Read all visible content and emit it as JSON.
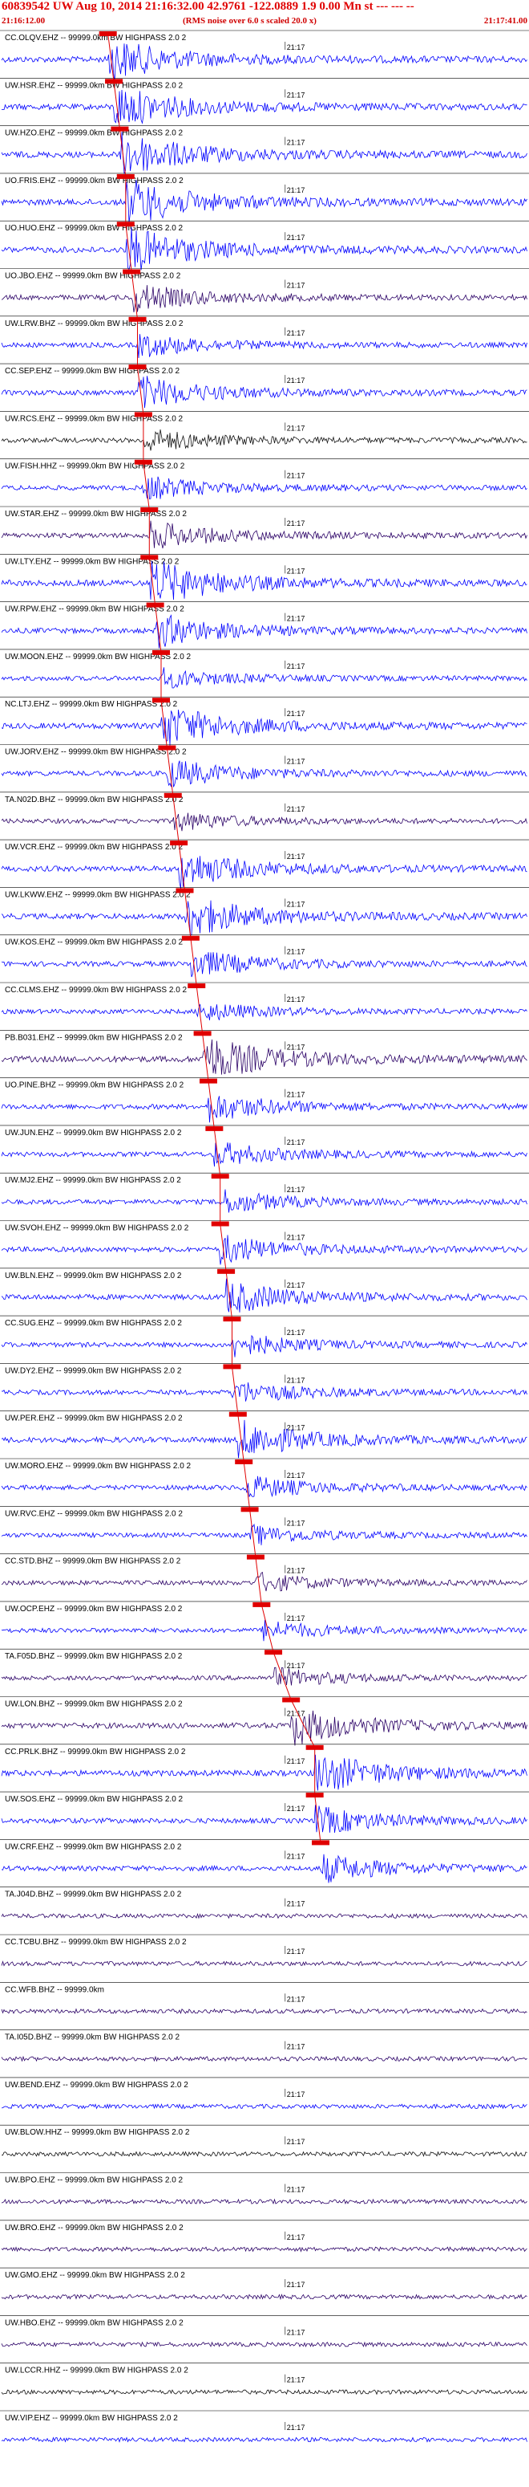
{
  "header": {
    "title": "60839542 UW Aug 10, 2014 21:16:32.00   42.9761 -122.0889  1.9 0.00 Mn st --- --- --",
    "start_time": "21:16:12.00",
    "note": "(RMS noise over 6.0 s scaled 20.0 x)",
    "end_time": "21:17:41.00"
  },
  "colors": {
    "trace_blue": "#0000ff",
    "trace_dark": "#2a0066",
    "trace_black": "#111111",
    "pick": "#e00000",
    "divider": "#000000"
  },
  "chart_data": {
    "type": "line",
    "title": "60839542 UW Aug 10, 2014 21:16:32.00   42.9761 -122.0889  1.9 0.00 Mn st --- --- --",
    "x_range": [
      "21:16:12.00",
      "21:17:41.00"
    ],
    "tick_label": "21:17",
    "tick_time": "21:17:00",
    "event_time": "21:16:32.00",
    "grid": false,
    "series": [
      {
        "label": "CC.OLQV.EHZ -- 99999.0km BW  HIGHPASS  2.0  2",
        "color": "blue",
        "arrival": "21:16:30",
        "amp": 0.9
      },
      {
        "label": "UW.HSR.EHZ -- 99999.0km BW  HIGHPASS  2.0  2",
        "color": "blue",
        "arrival": "21:16:31",
        "amp": 0.9
      },
      {
        "label": "UW.HZO.EHZ -- 99999.0km BW  HIGHPASS  2.0  2",
        "color": "blue",
        "arrival": "21:16:32",
        "amp": 1.0
      },
      {
        "label": "UO.FRIS.EHZ -- 99999.0km BW  HIGHPASS  2.0  2",
        "color": "blue",
        "arrival": "21:16:33",
        "amp": 1.0
      },
      {
        "label": "UO.HUO.EHZ -- 99999.0km BW  HIGHPASS  2.0  2",
        "color": "blue",
        "arrival": "21:16:33",
        "amp": 1.0
      },
      {
        "label": "UO.JBO.EHZ -- 99999.0km BW  HIGHPASS  2.0  2",
        "color": "dark",
        "arrival": "21:16:34",
        "amp": 0.6
      },
      {
        "label": "UW.LRW.BHZ -- 99999.0km BW  HIGHPASS  2.0  2",
        "color": "blue",
        "arrival": "21:16:35",
        "amp": 0.5
      },
      {
        "label": "CC.SEP.EHZ -- 99999.0km BW  HIGHPASS  2.0  2",
        "color": "blue",
        "arrival": "21:16:35",
        "amp": 0.7
      },
      {
        "label": "UW.RCS.EHZ -- 99999.0km BW  HIGHPASS  2.0  2",
        "color": "black",
        "arrival": "21:16:36",
        "amp": 0.5
      },
      {
        "label": "UW.FISH.HHZ -- 99999.0km BW  HIGHPASS  2.0  2",
        "color": "blue",
        "arrival": "21:16:36",
        "amp": 0.5
      },
      {
        "label": "UW.STAR.EHZ -- 99999.0km BW  HIGHPASS  2.0  2",
        "color": "dark",
        "arrival": "21:16:37",
        "amp": 0.6
      },
      {
        "label": "UW.LTY.EHZ -- 99999.0km BW  HIGHPASS  2.0  2",
        "color": "blue",
        "arrival": "21:16:37",
        "amp": 1.0
      },
      {
        "label": "UW.RPW.EHZ -- 99999.0km BW  HIGHPASS  2.0  2",
        "color": "blue",
        "arrival": "21:16:38",
        "amp": 0.7
      },
      {
        "label": "UW.MOON.EHZ -- 99999.0km BW  HIGHPASS  2.0  2",
        "color": "blue",
        "arrival": "21:16:39",
        "amp": 0.4
      },
      {
        "label": "NC.LTJ.EHZ -- 99999.0km BW  HIGHPASS  2.0  2",
        "color": "blue",
        "arrival": "21:16:39",
        "amp": 0.9
      },
      {
        "label": "UW.JORV.EHZ -- 99999.0km BW  HIGHPASS  2.0  2",
        "color": "blue",
        "arrival": "21:16:40",
        "amp": 0.6
      },
      {
        "label": "TA.N02D.BHZ -- 99999.0km BW  HIGHPASS  2.0  2",
        "color": "dark",
        "arrival": "21:16:41",
        "amp": 0.4
      },
      {
        "label": "UW.VCR.EHZ -- 99999.0km BW  HIGHPASS  2.0  2",
        "color": "blue",
        "arrival": "21:16:42",
        "amp": 0.8
      },
      {
        "label": "UW.LKWW.EHZ -- 99999.0km BW  HIGHPASS  2.0  2",
        "color": "blue",
        "arrival": "21:16:43",
        "amp": 0.9
      },
      {
        "label": "UW.KOS.EHZ -- 99999.0km BW  HIGHPASS  2.0  2",
        "color": "blue",
        "arrival": "21:16:44",
        "amp": 0.6
      },
      {
        "label": "CC.CLMS.EHZ -- 99999.0km BW  HIGHPASS  2.0  2",
        "color": "blue",
        "arrival": "21:16:45",
        "amp": 0.4
      },
      {
        "label": "PB.B031.EHZ -- 99999.0km BW  HIGHPASS  2.0  2",
        "color": "dark",
        "arrival": "21:16:46",
        "amp": 1.0
      },
      {
        "label": "UO.PINE.BHZ -- 99999.0km BW  HIGHPASS  2.0  2",
        "color": "blue",
        "arrival": "21:16:47",
        "amp": 0.6
      },
      {
        "label": "UW.JUN.EHZ -- 99999.0km BW  HIGHPASS  2.0  2",
        "color": "blue",
        "arrival": "21:16:48",
        "amp": 0.5
      },
      {
        "label": "UW.MJ2.EHZ -- 99999.0km BW  HIGHPASS  2.0  2",
        "color": "blue",
        "arrival": "21:16:49",
        "amp": 0.5
      },
      {
        "label": "UW.SVOH.EHZ -- 99999.0km BW  HIGHPASS  2.0  2",
        "color": "blue",
        "arrival": "21:16:49",
        "amp": 0.6
      },
      {
        "label": "UW.BLN.EHZ -- 99999.0km BW  HIGHPASS  2.0  2",
        "color": "blue",
        "arrival": "21:16:50",
        "amp": 0.7
      },
      {
        "label": "CC.SUG.EHZ -- 99999.0km BW  HIGHPASS  2.0  2",
        "color": "blue",
        "arrival": "21:16:51",
        "amp": 0.5
      },
      {
        "label": "UW.DY2.EHZ -- 99999.0km BW  HIGHPASS  2.0  2",
        "color": "blue",
        "arrival": "21:16:51",
        "amp": 0.5
      },
      {
        "label": "UW.PER.EHZ -- 99999.0km BW  HIGHPASS  2.0  2",
        "color": "blue",
        "arrival": "21:16:52",
        "amp": 0.8
      },
      {
        "label": "UW.MORO.EHZ -- 99999.0km BW  HIGHPASS  2.0  2",
        "color": "blue",
        "arrival": "21:16:53",
        "amp": 0.5
      },
      {
        "label": "UW.RVC.EHZ -- 99999.0km BW  HIGHPASS  2.0  2",
        "color": "blue",
        "arrival": "21:16:54",
        "amp": 0.4
      },
      {
        "label": "CC.STD.BHZ -- 99999.0km BW  HIGHPASS  2.0  2",
        "color": "dark",
        "arrival": "21:16:55",
        "amp": 0.4
      },
      {
        "label": "UW.OCP.EHZ -- 99999.0km BW  HIGHPASS  2.0  2",
        "color": "blue",
        "arrival": "21:16:56",
        "amp": 0.4
      },
      {
        "label": "TA.F05D.BHZ -- 99999.0km BW  HIGHPASS  2.0  2",
        "color": "dark",
        "arrival": "21:16:58",
        "amp": 0.4
      },
      {
        "label": "UW.LON.BHZ -- 99999.0km BW  HIGHPASS  2.0  2",
        "color": "dark",
        "arrival": "21:17:01",
        "amp": 0.8
      },
      {
        "label": "CC.PRLK.BHZ -- 99999.0km BW  HIGHPASS  2.0  2",
        "color": "blue",
        "arrival": "21:17:05",
        "amp": 0.9
      },
      {
        "label": "UW.SOS.EHZ -- 99999.0km BW  HIGHPASS  2.0  2",
        "color": "blue",
        "arrival": "21:17:05",
        "amp": 0.6
      },
      {
        "label": "UW.CRF.EHZ -- 99999.0km BW  HIGHPASS  2.0  2",
        "color": "blue",
        "arrival": "21:17:06",
        "amp": 0.6
      },
      {
        "label": "TA.J04D.BHZ -- 99999.0km BW  HIGHPASS  2.0  2",
        "color": "dark",
        "arrival": "",
        "amp": 0.3
      },
      {
        "label": "CC.TCBU.BHZ -- 99999.0km BW  HIGHPASS  2.0  2",
        "color": "dark",
        "arrival": "",
        "amp": 0.3
      },
      {
        "label": "CC.WFB.BHZ -- 99999.0km",
        "color": "dark",
        "arrival": "",
        "amp": 0.3
      },
      {
        "label": "TA.I05D.BHZ -- 99999.0km BW  HIGHPASS  2.0  2",
        "color": "dark",
        "arrival": "",
        "amp": 0.3
      },
      {
        "label": "UW.BEND.EHZ -- 99999.0km BW  HIGHPASS  2.0  2",
        "color": "blue",
        "arrival": "",
        "amp": 0.3
      },
      {
        "label": "UW.BLOW.HHZ -- 99999.0km BW  HIGHPASS  2.0  2",
        "color": "black",
        "arrival": "",
        "amp": 0.3
      },
      {
        "label": "UW.BPO.EHZ -- 99999.0km BW  HIGHPASS  2.0  2",
        "color": "dark",
        "arrival": "",
        "amp": 0.3
      },
      {
        "label": "UW.BRO.EHZ -- 99999.0km BW  HIGHPASS  2.0  2",
        "color": "dark",
        "arrival": "",
        "amp": 0.3
      },
      {
        "label": "UW.GMO.EHZ -- 99999.0km BW  HIGHPASS  2.0  2",
        "color": "dark",
        "arrival": "",
        "amp": 0.3
      },
      {
        "label": "UW.HBO.EHZ -- 99999.0km BW  HIGHPASS  2.0  2",
        "color": "dark",
        "arrival": "",
        "amp": 0.3
      },
      {
        "label": "UW.LCCR.HHZ -- 99999.0km BW  HIGHPASS  2.0  2",
        "color": "black",
        "arrival": "",
        "amp": 0.3
      },
      {
        "label": "UW.VIP.EHZ -- 99999.0km BW  HIGHPASS  2.0  2",
        "color": "blue",
        "arrival": "",
        "amp": 0.3
      }
    ]
  }
}
